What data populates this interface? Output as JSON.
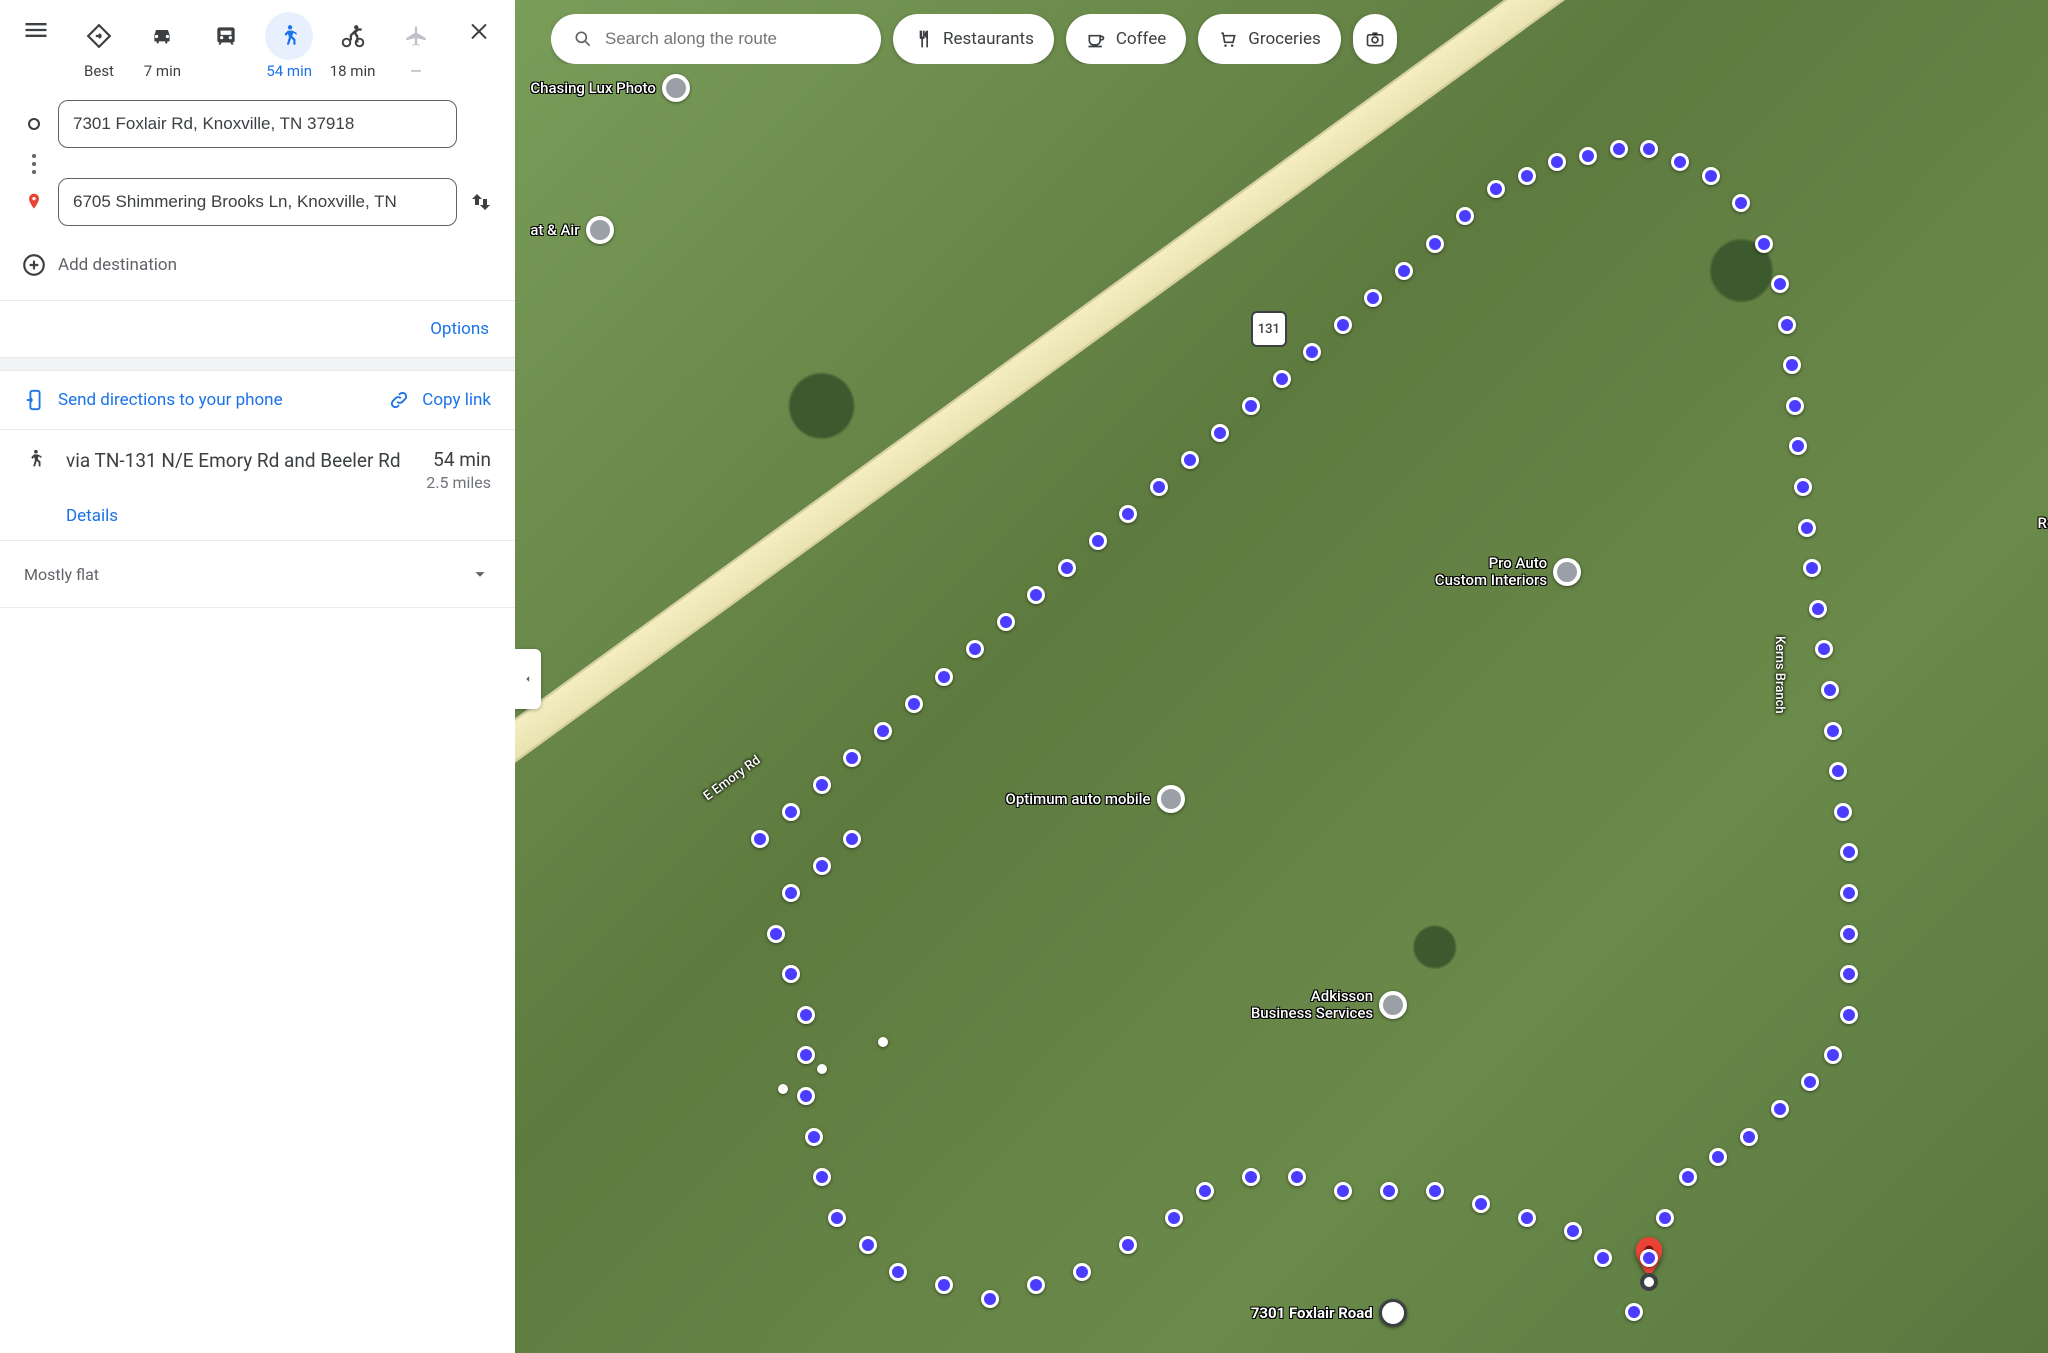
{
  "modes": {
    "best": {
      "label": "Best"
    },
    "drive": {
      "label": "7 min"
    },
    "transit": {
      "label": ""
    },
    "walk": {
      "label": "54 min"
    },
    "bike": {
      "label": "18 min"
    },
    "flight": {
      "label": "—"
    }
  },
  "waypoints": {
    "origin": "7301 Foxlair Rd, Knoxville, TN 37918",
    "destination": "6705 Shimmering Brooks Ln, Knoxville, TN"
  },
  "add_destination": "Add destination",
  "options_label": "Options",
  "actions": {
    "send": "Send directions to your phone",
    "copy": "Copy link"
  },
  "route": {
    "title": "via TN-131 N/E Emory Rd and Beeler Rd",
    "time": "54 min",
    "distance": "2.5 miles",
    "details": "Details"
  },
  "terrain": "Mostly flat",
  "search": {
    "placeholder": "Search along the route"
  },
  "chips": {
    "restaurants": "Restaurants",
    "coffee": "Coffee",
    "groceries": "Groceries"
  },
  "route_shield": "131",
  "map_labels": {
    "emory": "E Emory Rd",
    "kerns": "Kerns Branch",
    "foxlair": "7301 Foxlair Road"
  },
  "pois": {
    "chasing_lux": "Chasing Lux Photo",
    "heat_air": "at & Air",
    "pro_auto": "Pro Auto\nCustom Interiors",
    "optimum": "Optimum auto mobile",
    "adkisson": "Adkisson\nBusiness Services",
    "roc": "Roc"
  }
}
